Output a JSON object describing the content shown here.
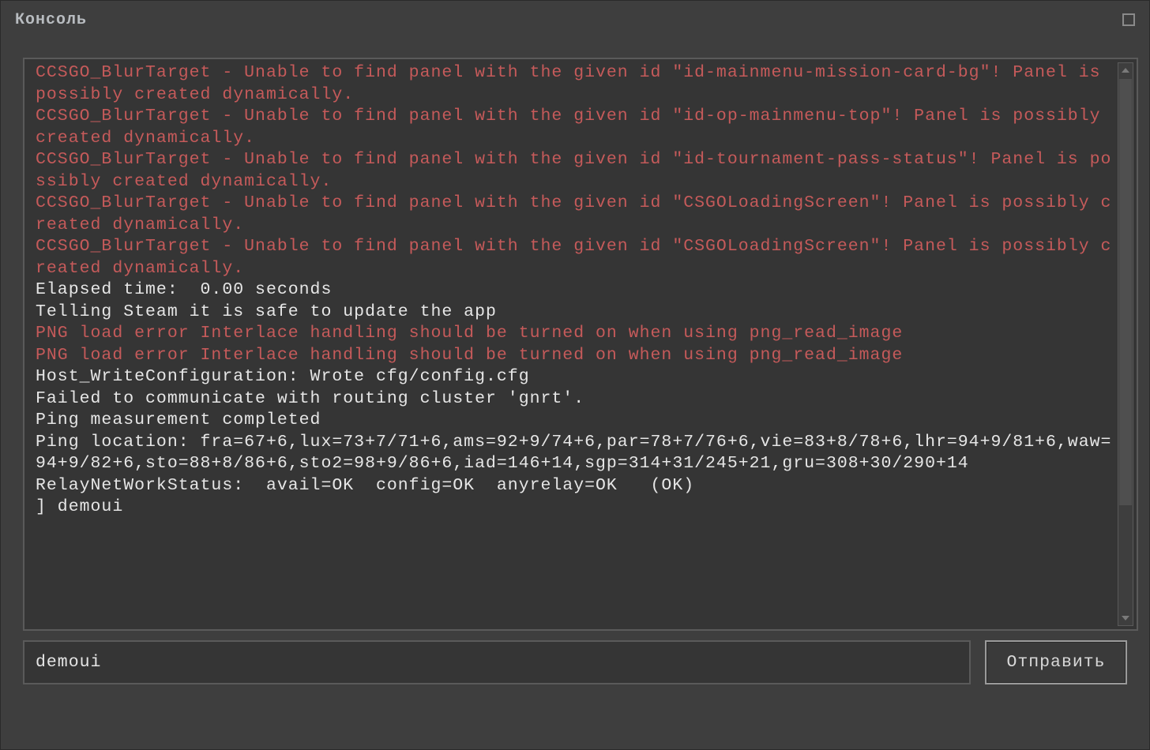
{
  "window": {
    "title": "Консоль"
  },
  "console": {
    "lines": [
      {
        "cls": "red",
        "text": "CCSGO_BlurTarget - Unable to find panel with the given id \"id-mainmenu-mission-card-bg\"! Panel is possibly created dynamically."
      },
      {
        "cls": "red",
        "text": "CCSGO_BlurTarget - Unable to find panel with the given id \"id-op-mainmenu-top\"! Panel is possibly created dynamically."
      },
      {
        "cls": "red",
        "text": "CCSGO_BlurTarget - Unable to find panel with the given id \"id-tournament-pass-status\"! Panel is possibly created dynamically."
      },
      {
        "cls": "red",
        "text": "CCSGO_BlurTarget - Unable to find panel with the given id \"CSGOLoadingScreen\"! Panel is possibly created dynamically."
      },
      {
        "cls": "red",
        "text": "CCSGO_BlurTarget - Unable to find panel with the given id \"CSGOLoadingScreen\"! Panel is possibly created dynamically."
      },
      {
        "cls": "white",
        "text": "Elapsed time:  0.00 seconds"
      },
      {
        "cls": "white",
        "text": "Telling Steam it is safe to update the app"
      },
      {
        "cls": "red",
        "text": "PNG load error Interlace handling should be turned on when using png_read_image"
      },
      {
        "cls": "red",
        "text": "PNG load error Interlace handling should be turned on when using png_read_image"
      },
      {
        "cls": "white",
        "text": "Host_WriteConfiguration: Wrote cfg/config.cfg"
      },
      {
        "cls": "white",
        "text": "Failed to communicate with routing cluster 'gnrt'."
      },
      {
        "cls": "white",
        "text": "Ping measurement completed"
      },
      {
        "cls": "white",
        "text": "Ping location: fra=67+6,lux=73+7/71+6,ams=92+9/74+6,par=78+7/76+6,vie=83+8/78+6,lhr=94+9/81+6,waw=94+9/82+6,sto=88+8/86+6,sto2=98+9/86+6,iad=146+14,sgp=314+31/245+21,gru=308+30/290+14"
      },
      {
        "cls": "white",
        "text": "RelayNetWorkStatus:  avail=OK  config=OK  anyrelay=OK   (OK)"
      },
      {
        "cls": "white",
        "text": "] demoui"
      }
    ]
  },
  "input": {
    "value": "demoui "
  },
  "buttons": {
    "submit_label": "Отправить"
  }
}
